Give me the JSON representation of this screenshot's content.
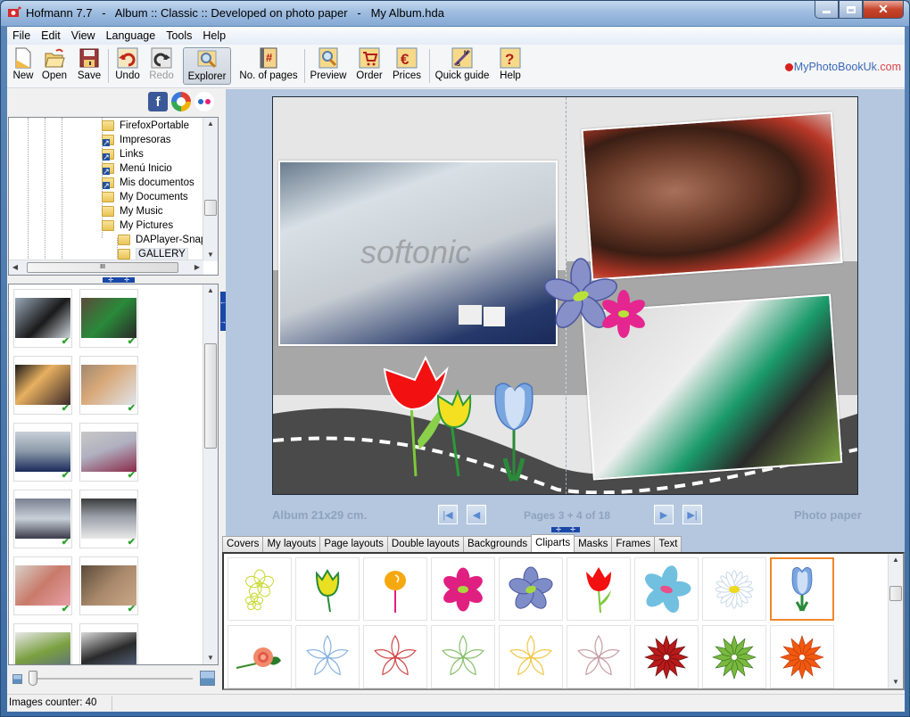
{
  "window": {
    "title": "Hofmann 7.7   -   Album :: Classic :: Developed on photo paper   -   My Album.hda",
    "minimize_label": "—",
    "maximize_label": "☐",
    "close_label": "✕"
  },
  "menu": [
    "File",
    "Edit",
    "View",
    "Language",
    "Tools",
    "Help"
  ],
  "toolbar": {
    "new": "New",
    "open": "Open",
    "save": "Save",
    "undo": "Undo",
    "redo": "Redo",
    "explorer": "Explorer",
    "pages": "No. of pages",
    "preview": "Preview",
    "order": "Order",
    "prices": "Prices",
    "guide": "Quick guide",
    "help": "Help"
  },
  "brand": {
    "name": "MyPhotoBookUk",
    "suffix": ".com"
  },
  "social": {
    "facebook": "f"
  },
  "tree": {
    "items": [
      {
        "label": "FirefoxPortable",
        "type": "folder",
        "selected": false
      },
      {
        "label": "Impresoras",
        "type": "shortcut",
        "selected": false
      },
      {
        "label": "Links",
        "type": "folder",
        "selected": false
      },
      {
        "label": "Menú Inicio",
        "type": "shortcut",
        "selected": false
      },
      {
        "label": "Mis documentos",
        "type": "shortcut",
        "selected": false
      },
      {
        "label": "My Documents",
        "type": "folder",
        "selected": false
      },
      {
        "label": "My Music",
        "type": "folder",
        "selected": false
      },
      {
        "label": "My Pictures",
        "type": "folder",
        "selected": false
      },
      {
        "label": "DAPlayer-Snapsh",
        "type": "folder",
        "selected": false
      },
      {
        "label": "GALLERY",
        "type": "folder",
        "selected": true
      }
    ],
    "hscroll_grip": "III"
  },
  "thumbnails": {
    "count_shown": 12,
    "checked": [
      true,
      true,
      true,
      true,
      true,
      true,
      true,
      true,
      true,
      true,
      false,
      false
    ]
  },
  "status": {
    "images_counter": "Images counter: 40"
  },
  "editor": {
    "album_size": "Album 21x29 cm.",
    "pages": "Pages 3 + 4 of 18",
    "paper": "Photo paper",
    "nav": {
      "first": "|◀",
      "prev": "◀",
      "next": "▶",
      "last": "▶|"
    }
  },
  "tabs": [
    {
      "label": "Covers",
      "active": false
    },
    {
      "label": "My layouts",
      "active": false
    },
    {
      "label": "Page layouts",
      "active": false
    },
    {
      "label": "Double layouts",
      "active": false
    },
    {
      "label": "Backgrounds",
      "active": false
    },
    {
      "label": "Cliparts",
      "active": true
    },
    {
      "label": "Masks",
      "active": false
    },
    {
      "label": "Frames",
      "active": false
    },
    {
      "label": "Text",
      "active": false
    }
  ],
  "cliparts": {
    "row1": [
      "yellow-outline-flowers",
      "yellow-tulip",
      "orange-flower",
      "pink-flower",
      "blue-flower",
      "red-tulip",
      "light-blue-flower",
      "daisy",
      "blue-tulip"
    ],
    "row2": [
      "rose",
      "blue-lily",
      "red-lily",
      "green-lily",
      "yellow-lily",
      "pink-lily",
      "red-star-flower",
      "green-star-flower",
      "orange-star-flower"
    ],
    "selected": "blue-tulip",
    "colors": {
      "selected_border": "#f0882c"
    }
  }
}
